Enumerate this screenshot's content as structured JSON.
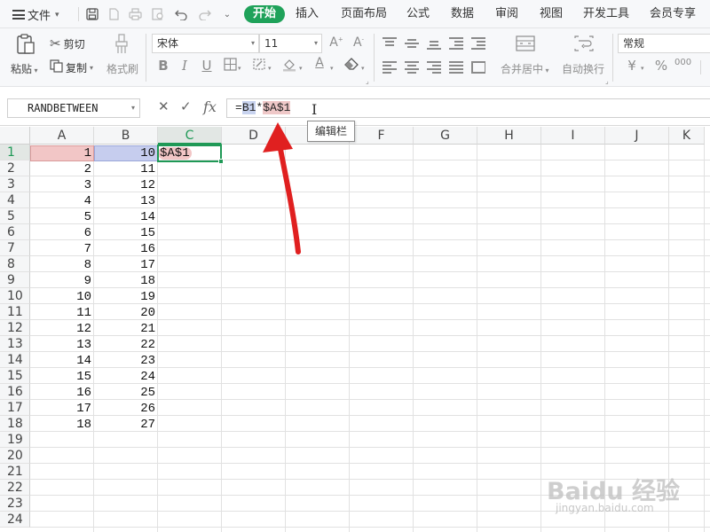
{
  "menubar": {
    "file_label": "文件",
    "tabs": [
      "开始",
      "插入",
      "页面布局",
      "公式",
      "数据",
      "审阅",
      "视图",
      "开发工具",
      "会员专享"
    ],
    "active_tab": "开始"
  },
  "ribbon": {
    "paste_label": "粘贴",
    "cut_label": "剪切",
    "copy_label": "复制",
    "format_painter_label": "格式刷",
    "font_name": "宋体",
    "font_size": "11",
    "merge_center_label": "合并居中",
    "wrap_text_label": "自动换行",
    "number_format": "常规",
    "currency_symbol": "¥",
    "percent_symbol": "%",
    "thousands_symbol": "000"
  },
  "formula_bar": {
    "name_box": "RANDBETWEEN",
    "fx_label": "fx",
    "formula_prefix": "=",
    "formula_ref_b": "B1",
    "formula_op": "*",
    "formula_ref_a": "$A$1",
    "tooltip": "编辑栏"
  },
  "grid": {
    "columns": [
      "A",
      "B",
      "C",
      "D",
      "E",
      "F",
      "G",
      "H",
      "I",
      "J",
      "K"
    ],
    "active_column": "C",
    "rows": [
      "1",
      "2",
      "3",
      "4",
      "5",
      "6",
      "7",
      "8",
      "9",
      "10",
      "11",
      "12",
      "13",
      "14",
      "15",
      "16",
      "17",
      "18",
      "19",
      "20",
      "21",
      "22",
      "23",
      "24"
    ],
    "active_row": "1",
    "col_a_values": [
      "1",
      "2",
      "3",
      "4",
      "5",
      "6",
      "7",
      "8",
      "9",
      "10",
      "11",
      "12",
      "13",
      "14",
      "15",
      "16",
      "17",
      "18"
    ],
    "col_b_values": [
      "10",
      "11",
      "12",
      "13",
      "14",
      "15",
      "16",
      "17",
      "18",
      "19",
      "20",
      "21",
      "22",
      "23",
      "24",
      "25",
      "26",
      "27"
    ],
    "c1_value": "$A$1"
  },
  "watermark": {
    "brand": "Baidu 经验",
    "url": "jingyan.baidu.com"
  },
  "colors": {
    "accent": "#1fa25a",
    "ref_red": "#f2c6c6",
    "ref_blue": "#c6cdee",
    "arrow": "#e02020"
  }
}
